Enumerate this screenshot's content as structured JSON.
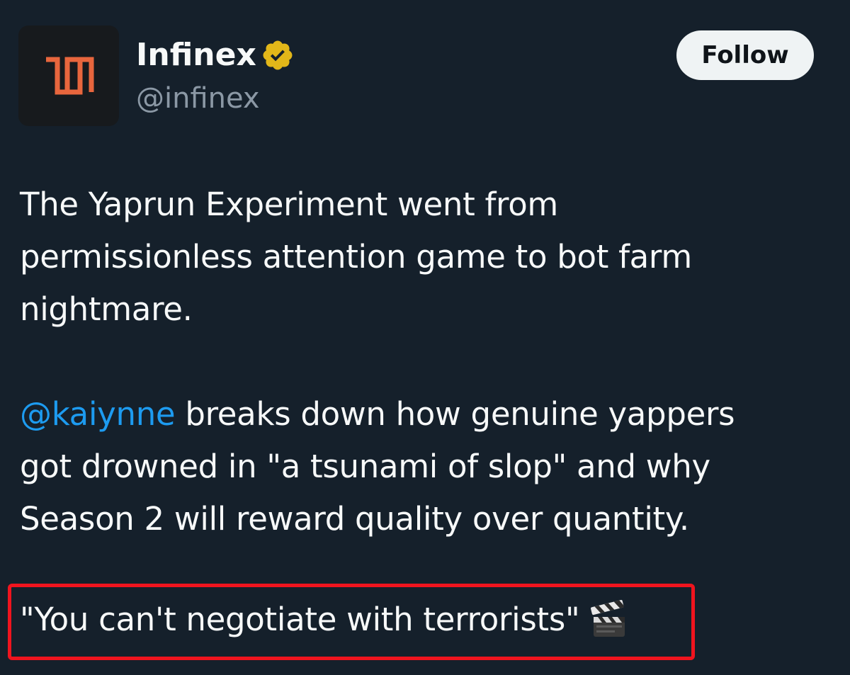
{
  "account": {
    "display_name": "Infinex",
    "handle": "@infinex",
    "verified": true,
    "avatar_icon": "infinex-logo-icon",
    "badge_icon": "verified-badge-icon"
  },
  "follow_button": {
    "label": "Follow"
  },
  "tweet": {
    "paragraph1": {
      "line1": "The Yaprun Experiment went from",
      "line2": "permissionless attention game to bot farm",
      "line3": "nightmare."
    },
    "paragraph2": {
      "mention": "@kaiynne",
      "line1_rest": " breaks down how genuine yappers",
      "line2": "got drowned in \"a tsunami of slop\" and why",
      "line3": "Season 2 will reward quality over quantity."
    },
    "quote": {
      "text": "\"You can't negotiate with terrorists\"",
      "emoji_icon": "clapper-board-icon"
    }
  },
  "colors": {
    "background": "#15202b",
    "text": "#f7f9f9",
    "secondary_text": "#8b98a5",
    "mention": "#1d9bf0",
    "verified_gold": "#e2b719",
    "logo_orange": "#e8663d",
    "highlight_border": "#f0141e",
    "button_bg": "#eff3f4"
  }
}
